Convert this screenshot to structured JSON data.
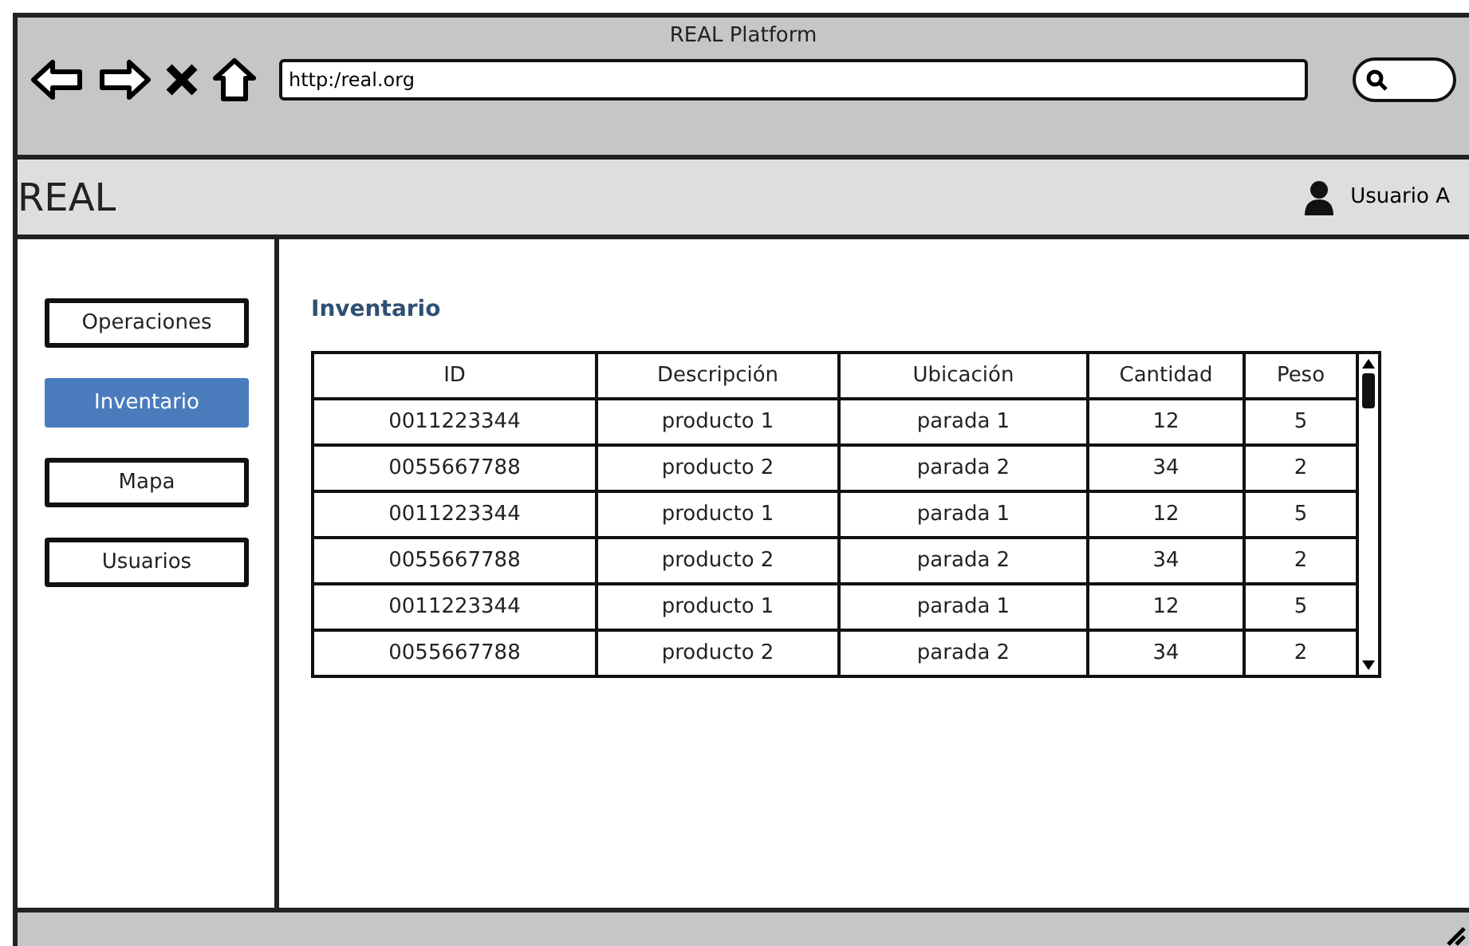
{
  "window": {
    "title": "REAL Platform"
  },
  "browser": {
    "address": "http:/real.org"
  },
  "header": {
    "logo": "REAL",
    "user": "Usuario A"
  },
  "sidebar": {
    "items": [
      {
        "label": "Operaciones",
        "selected": false
      },
      {
        "label": "Inventario",
        "selected": true
      },
      {
        "label": "Mapa",
        "selected": false
      },
      {
        "label": "Usuarios",
        "selected": false
      }
    ]
  },
  "content": {
    "title": "Inventario",
    "table": {
      "columns": [
        "ID",
        "Descripción",
        "Ubicación",
        "Cantidad",
        "Peso"
      ],
      "rows": [
        [
          "0011223344",
          "producto 1",
          "parada 1",
          "12",
          "5"
        ],
        [
          "0055667788",
          "producto 2",
          "parada 2",
          "34",
          "2"
        ],
        [
          "0011223344",
          "producto 1",
          "parada 1",
          "12",
          "5"
        ],
        [
          "0055667788",
          "producto 2",
          "parada 2",
          "34",
          "2"
        ],
        [
          "0011223344",
          "producto 1",
          "parada 1",
          "12",
          "5"
        ],
        [
          "0055667788",
          "producto 2",
          "parada 2",
          "34",
          "2"
        ]
      ]
    }
  }
}
